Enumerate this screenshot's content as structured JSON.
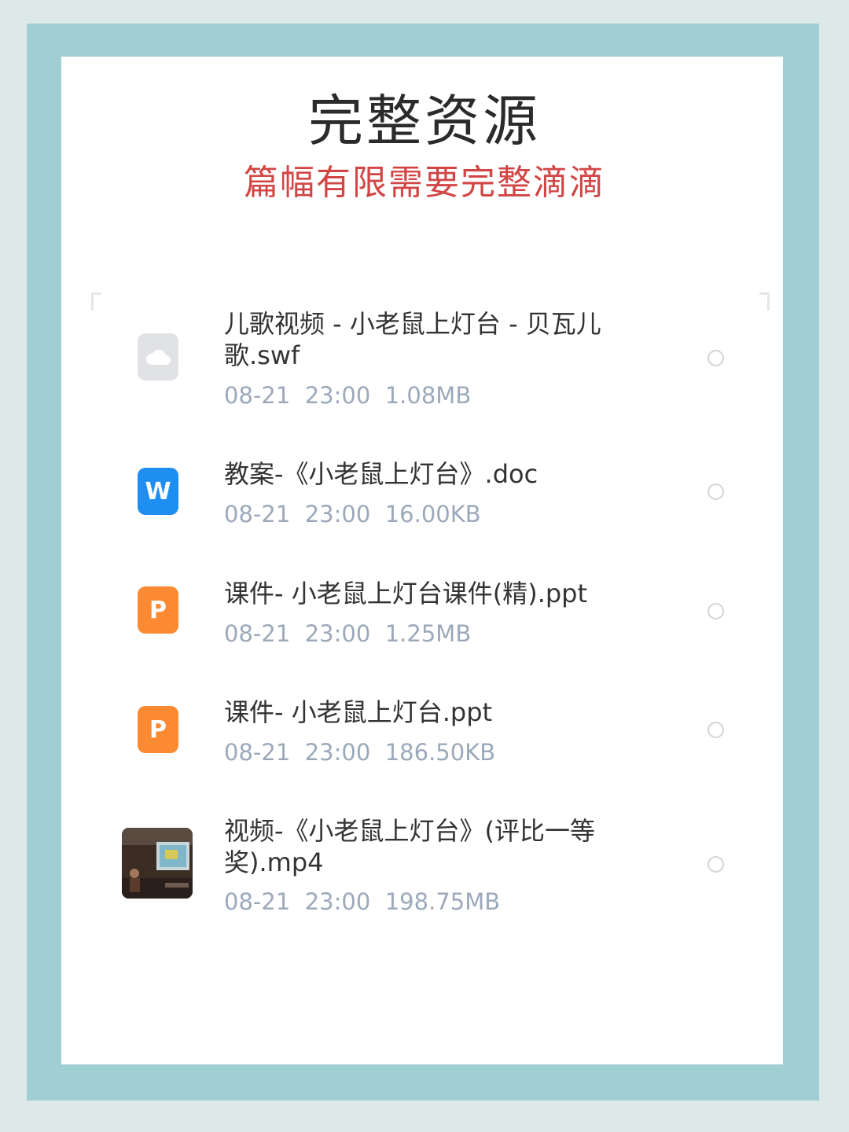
{
  "header": {
    "title": "完整资源",
    "subtitle": "篇幅有限需要完整滴滴"
  },
  "files": [
    {
      "name": "儿歌视频 - 小老鼠上灯台 - 贝瓦儿歌.swf",
      "date": "08-21",
      "time": "23:00",
      "size": "1.08MB",
      "icon": "cloud-file-icon",
      "icon_color": "#e1e2e6"
    },
    {
      "name": "教案-《小老鼠上灯台》.doc",
      "date": "08-21",
      "time": "23:00",
      "size": "16.00KB",
      "icon": "word-doc-icon",
      "icon_letter": "W",
      "icon_color": "#1f8ef1"
    },
    {
      "name": "课件- 小老鼠上灯台课件(精).ppt",
      "date": "08-21",
      "time": "23:00",
      "size": "1.25MB",
      "icon": "powerpoint-icon",
      "icon_letter": "P",
      "icon_color": "#fb8a32"
    },
    {
      "name": "课件- 小老鼠上灯台.ppt",
      "date": "08-21",
      "time": "23:00",
      "size": "186.50KB",
      "icon": "powerpoint-icon",
      "icon_letter": "P",
      "icon_color": "#fb8a32"
    },
    {
      "name": "视频-《小老鼠上灯台》(评比一等奖).mp4",
      "date": "08-21",
      "time": "23:00",
      "size": "198.75MB",
      "icon": "video-thumbnail"
    }
  ],
  "colors": {
    "frame": "#a0ced3",
    "subtitle": "#d24545",
    "meta_text": "#9ca9bb"
  }
}
